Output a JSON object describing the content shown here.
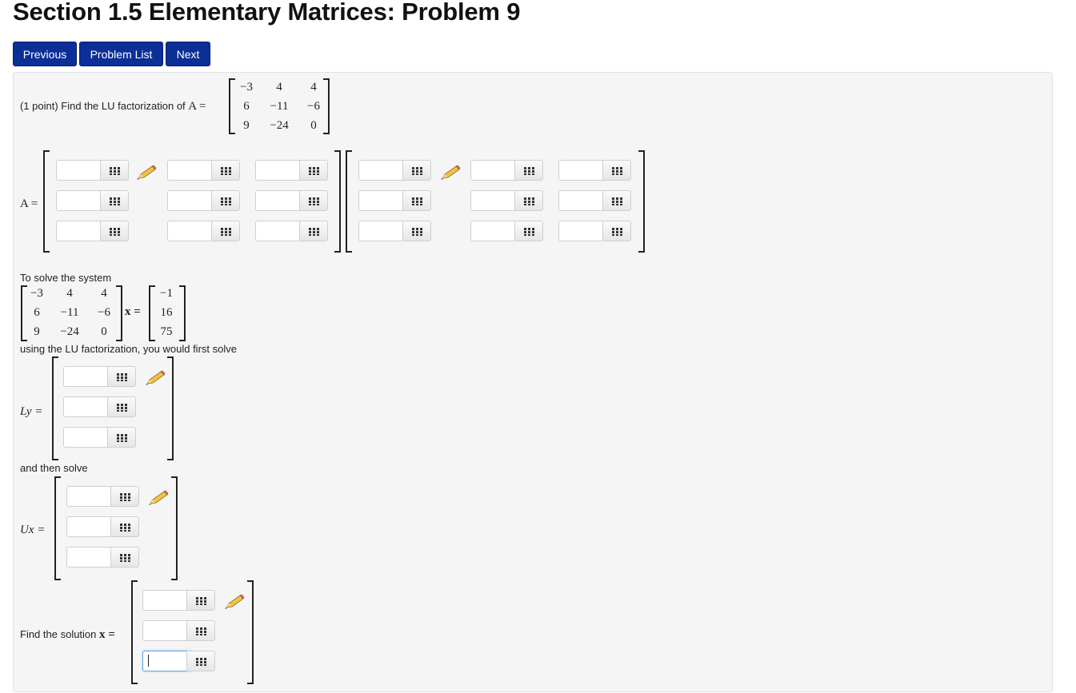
{
  "title": "Section 1.5 Elementary Matrices: Problem 9",
  "nav": {
    "previous": "Previous",
    "problem_list": "Problem List",
    "next": "Next"
  },
  "problem": {
    "intro": "(1 point) Find the LU factorization of",
    "a_label": "A =",
    "matrix_A": [
      [
        "−3",
        "4",
        "4"
      ],
      [
        "6",
        "−11",
        "−6"
      ],
      [
        "9",
        "−24",
        "0"
      ]
    ],
    "lu_label": "A =",
    "solve_intro": "To solve the system",
    "x_eq": "x =",
    "rhs": [
      "−1",
      "16",
      "75"
    ],
    "using_text": "using the LU factorization, you would first solve",
    "ly_label": "Ly =",
    "then_text": "and then solve",
    "ux_label": "Ux =",
    "solution_text": "Find the solution",
    "solution_label": "x ="
  },
  "icons": {
    "palette": "matrix-palette-icon",
    "pencil": "pencil-icon"
  },
  "colors": {
    "nav_button": "#0b2e97",
    "panel_bg": "#f5f5f5",
    "focus": "#6aa7e0"
  }
}
